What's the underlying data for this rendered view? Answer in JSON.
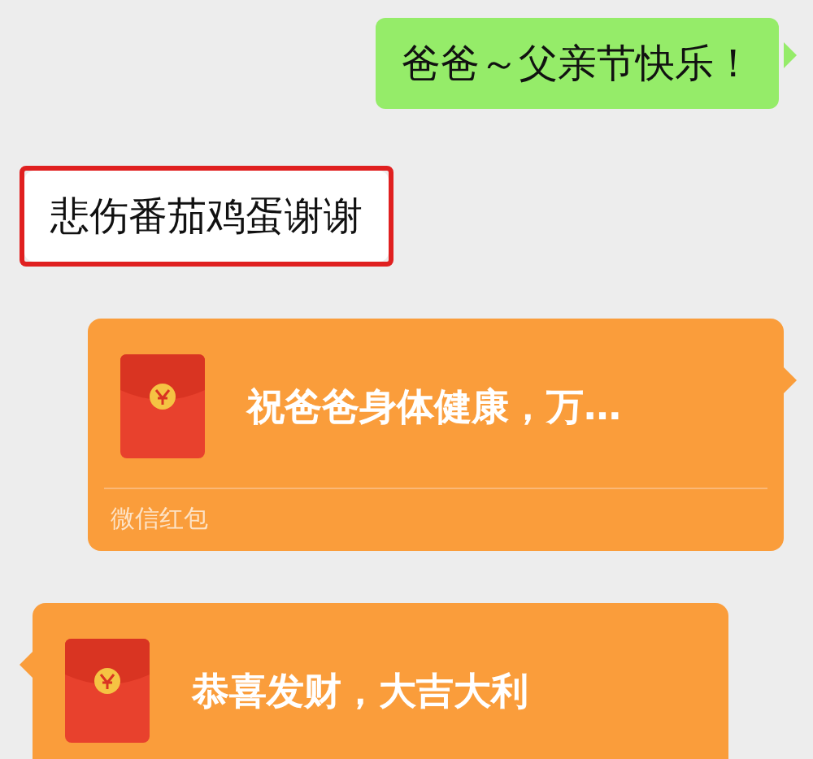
{
  "messages": [
    {
      "kind": "text",
      "outgoing": true,
      "text": "爸爸～父亲节快乐！",
      "highlighted": false
    },
    {
      "kind": "text",
      "outgoing": false,
      "text": "悲伤番茄鸡蛋谢谢",
      "highlighted": true
    },
    {
      "kind": "red_packet",
      "outgoing": true,
      "text": "祝爸爸身体健康，万…",
      "footer": "微信红包"
    },
    {
      "kind": "red_packet",
      "outgoing": false,
      "text": "恭喜发财，大吉大利"
    }
  ]
}
